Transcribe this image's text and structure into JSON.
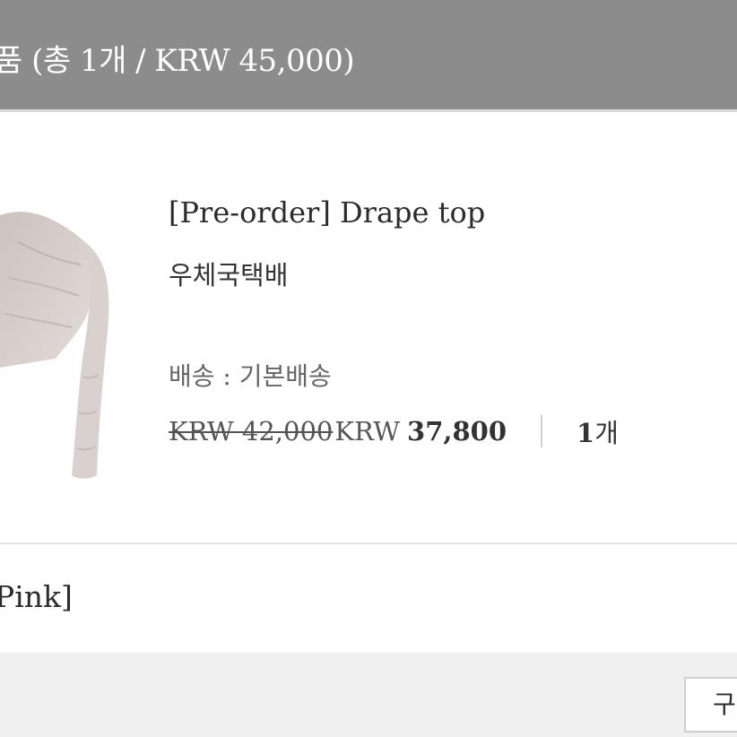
{
  "header": {
    "title": "품 (총 1개 / KRW 45,000)"
  },
  "product": {
    "name": "[Pre-order] Drape top",
    "carrier": "우체국택배",
    "shipping": "배송 : 기본배송",
    "old_price": "KRW 42,000",
    "new_currency": "KRW",
    "new_price": "37,800",
    "quantity_number": "1",
    "quantity_unit": "개",
    "image_color": "#d8d0cd"
  },
  "option": {
    "text": "Pink]"
  },
  "footer": {
    "button_label": "구"
  }
}
